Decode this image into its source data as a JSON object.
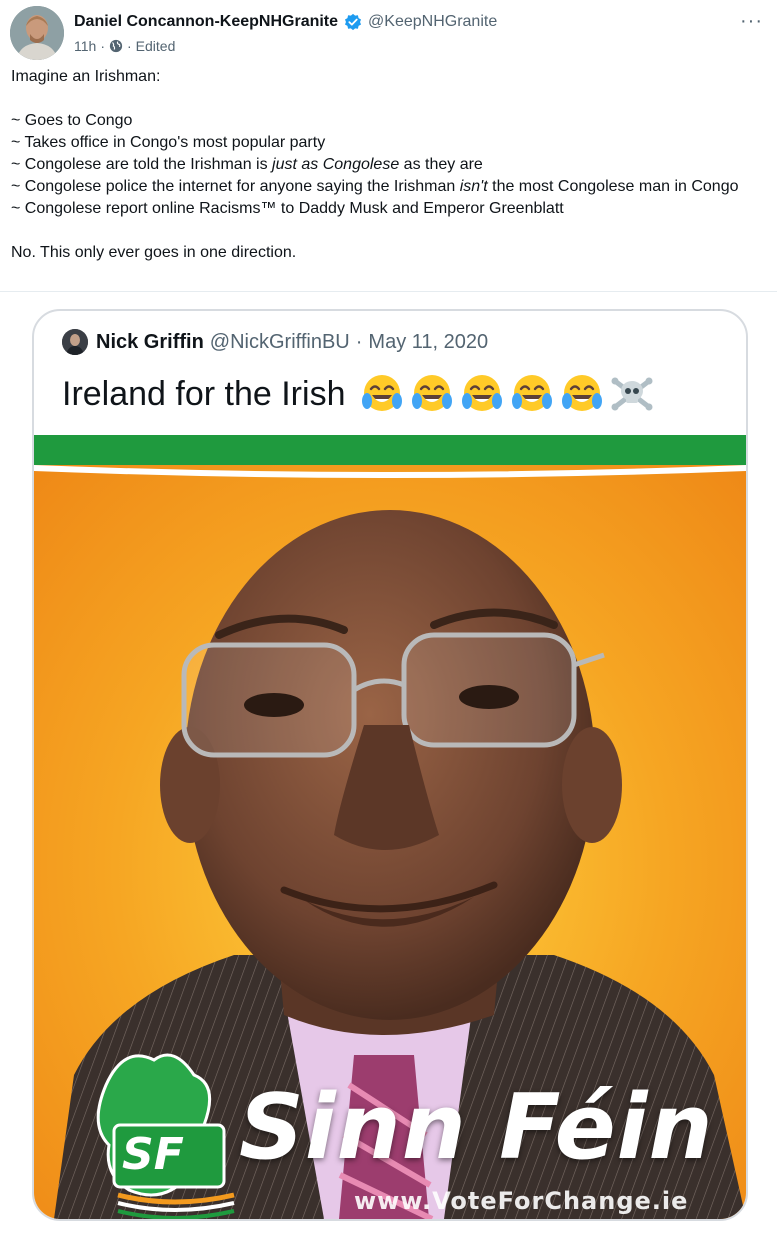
{
  "post": {
    "author_name": "Daniel Concannon-KeepNHGranite",
    "handle": "@KeepNHGranite",
    "time": "11h",
    "edited": "Edited",
    "more": "···",
    "lines": {
      "l1": "Imagine an Irishman:",
      "l2": "~ Goes to Congo",
      "l3": "~ Takes office in Congo's most popular party",
      "l4a": "~ Congolese are told the Irishman is ",
      "l4b": "just as Congolese",
      "l4c": " as they are",
      "l5a": "~ Congolese police the internet for anyone saying the Irishman ",
      "l5b": "isn't",
      "l5c": " the most Congolese man in Congo",
      "l6": "~ Congolese report online Racisms™ to Daddy Musk and Emperor Greenblatt",
      "l7": "No. This only ever goes in one direction."
    }
  },
  "quoted": {
    "name": "Nick Griffin",
    "handle": "@NickGriffinBU",
    "dot": "·",
    "date": "May 11, 2020",
    "text": "Ireland for the Irish"
  },
  "poster": {
    "logo": "SF",
    "brand": "Sinn Féin",
    "url": "www.VoteForChange.ie"
  },
  "colors": {
    "verified": "#1d9bf0",
    "green": "#1f9a3e",
    "orange": "#f39a1e"
  }
}
